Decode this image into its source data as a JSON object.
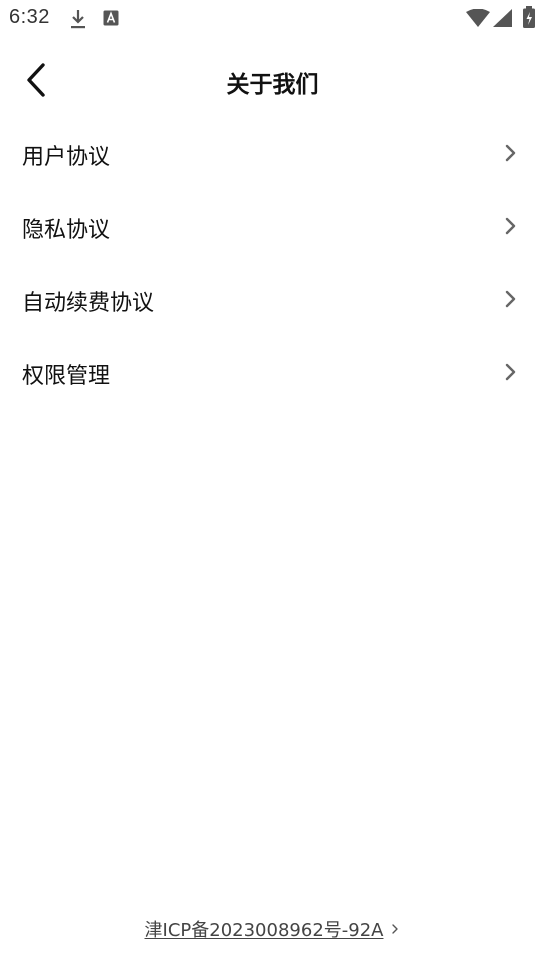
{
  "status_bar": {
    "time": "6:32",
    "icons": [
      "download-icon",
      "text-a-icon",
      "wifi-icon",
      "signal-icon",
      "battery-charging-icon"
    ]
  },
  "header": {
    "title": "关于我们",
    "back_icon": "chevron-left-icon"
  },
  "menu": {
    "items": [
      {
        "label": "用户协议"
      },
      {
        "label": "隐私协议"
      },
      {
        "label": "自动续费协议"
      },
      {
        "label": "权限管理"
      }
    ],
    "chevron_icon": "chevron-right-icon"
  },
  "footer": {
    "icp_text": "津ICP备2023008962号-92A"
  },
  "colors": {
    "background": "#ffffff",
    "text_primary": "#111111",
    "icon_gray": "#666666"
  }
}
